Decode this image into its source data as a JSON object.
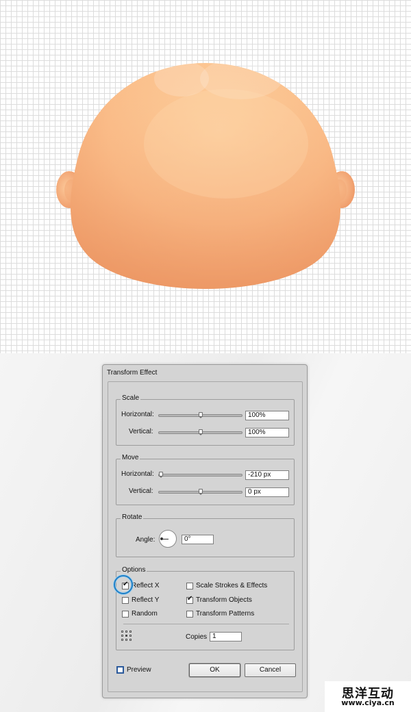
{
  "colors": {
    "skin_light": "#fdd2a0",
    "skin_mid": "#f9b884",
    "skin_dark": "#eb9060",
    "dialog_bg": "#d4d4d4",
    "focus_ring": "#1f7fc6"
  },
  "dialog": {
    "title": "Transform Effect",
    "scale": {
      "title": "Scale",
      "horizontal_label": "Horizontal:",
      "horizontal_value": "100%",
      "vertical_label": "Vertical:",
      "vertical_value": "100%"
    },
    "move": {
      "title": "Move",
      "horizontal_label": "Horizontal:",
      "horizontal_value": "-210 px",
      "vertical_label": "Vertical:",
      "vertical_value": "0 px"
    },
    "rotate": {
      "title": "Rotate",
      "angle_label": "Angle:",
      "angle_value": "0°"
    },
    "options": {
      "title": "Options",
      "reflect_x": {
        "label": "Reflect X",
        "checked": true
      },
      "reflect_y": {
        "label": "Reflect Y",
        "checked": false
      },
      "random": {
        "label": "Random",
        "checked": false
      },
      "scale_strokes": {
        "label": "Scale Strokes & Effects",
        "checked": false
      },
      "transform_objects": {
        "label": "Transform Objects",
        "checked": true
      },
      "transform_patterns": {
        "label": "Transform Patterns",
        "checked": false
      },
      "copies_label": "Copies",
      "copies_value": "1"
    },
    "preview_label": "Preview",
    "ok_label": "OK",
    "cancel_label": "Cancel"
  },
  "watermark": {
    "brand": "思洋互动",
    "url": "www.ciya.cn"
  }
}
